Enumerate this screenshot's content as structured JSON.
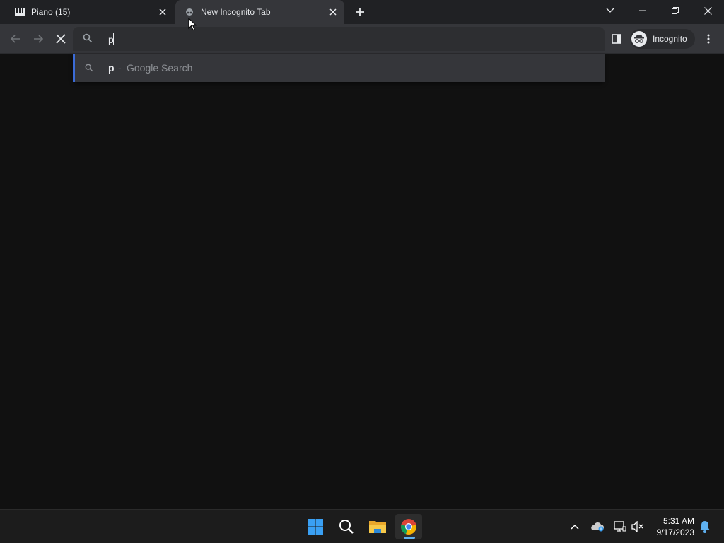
{
  "tabs": [
    {
      "title": "Piano (15)",
      "icon": "piano-icon",
      "active": false
    },
    {
      "title": "New Incognito Tab",
      "icon": "incognito-favicon-icon",
      "active": true
    }
  ],
  "omnibox": {
    "value": "p",
    "placeholder": ""
  },
  "profile": {
    "label": "Incognito",
    "icon": "incognito-icon"
  },
  "suggestion": {
    "query": "p",
    "separator": "-",
    "engine": "Google Search"
  },
  "taskbar": {
    "apps": [
      "windows-start-icon",
      "search-icon",
      "file-explorer-icon",
      "chrome-icon"
    ]
  },
  "clock": {
    "time": "5:31 AM",
    "date": "9/17/2023"
  },
  "colors": {
    "tab_strip": "#202124",
    "toolbar": "#35363a",
    "page": "#111111",
    "taskbar": "#1c1c1c",
    "accent": "#3b6bd6"
  }
}
